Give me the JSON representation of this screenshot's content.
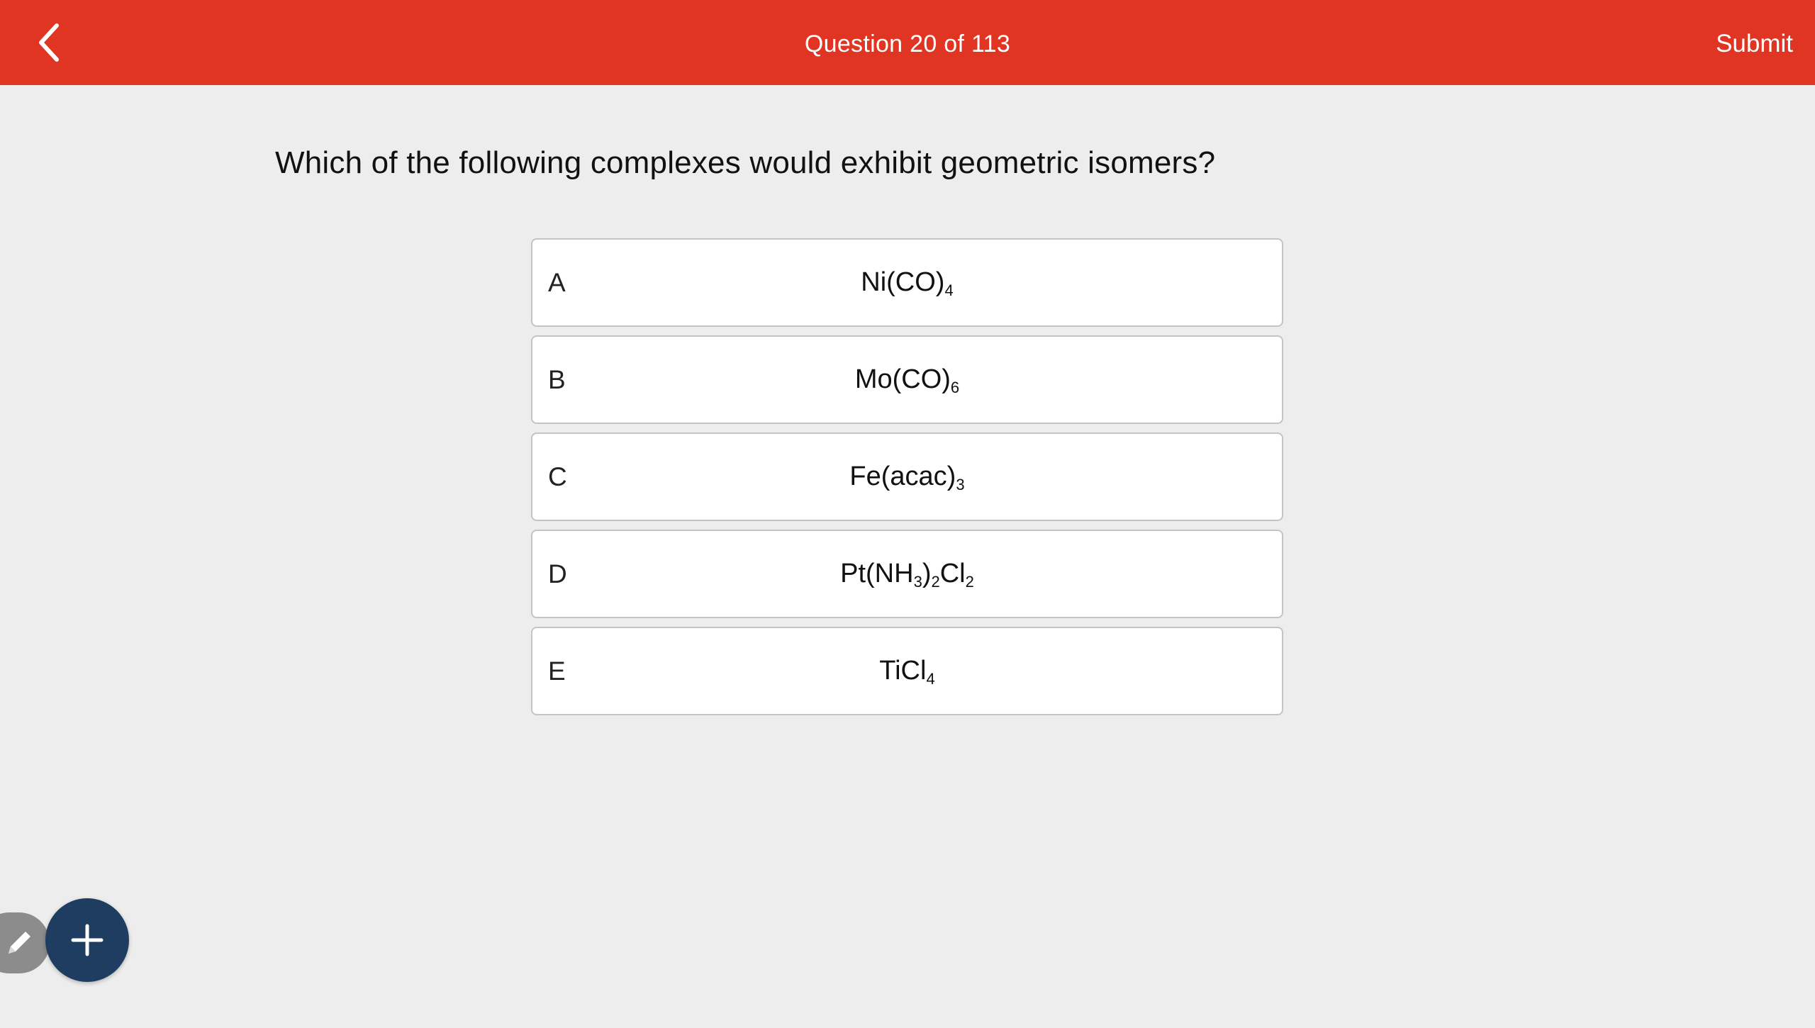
{
  "header": {
    "title": "Question 20 of 113",
    "submit_label": "Submit",
    "back_icon": "chevron-left-icon",
    "bar_color": "#e03523"
  },
  "question": {
    "text": "Which of the following complexes would exhibit geometric isomers?"
  },
  "options": [
    {
      "letter": "A",
      "formula": [
        {
          "t": "Ni(CO)"
        },
        {
          "sub": "4"
        }
      ]
    },
    {
      "letter": "B",
      "formula": [
        {
          "t": "Mo(CO)"
        },
        {
          "sub": "6"
        }
      ]
    },
    {
      "letter": "C",
      "formula": [
        {
          "t": "Fe(acac)"
        },
        {
          "sub": "3"
        }
      ]
    },
    {
      "letter": "D",
      "formula": [
        {
          "t": "Pt(NH"
        },
        {
          "sub": "3"
        },
        {
          "t": ")"
        },
        {
          "sub": "2"
        },
        {
          "t": "Cl"
        },
        {
          "sub": "2"
        }
      ]
    },
    {
      "letter": "E",
      "formula": [
        {
          "t": "TiCl"
        },
        {
          "sub": "4"
        }
      ]
    }
  ],
  "fab": {
    "pencil_icon": "pencil-icon",
    "plus_icon": "plus-icon",
    "plus_color": "#1f3d60",
    "pencil_color": "#8c8c8c"
  }
}
